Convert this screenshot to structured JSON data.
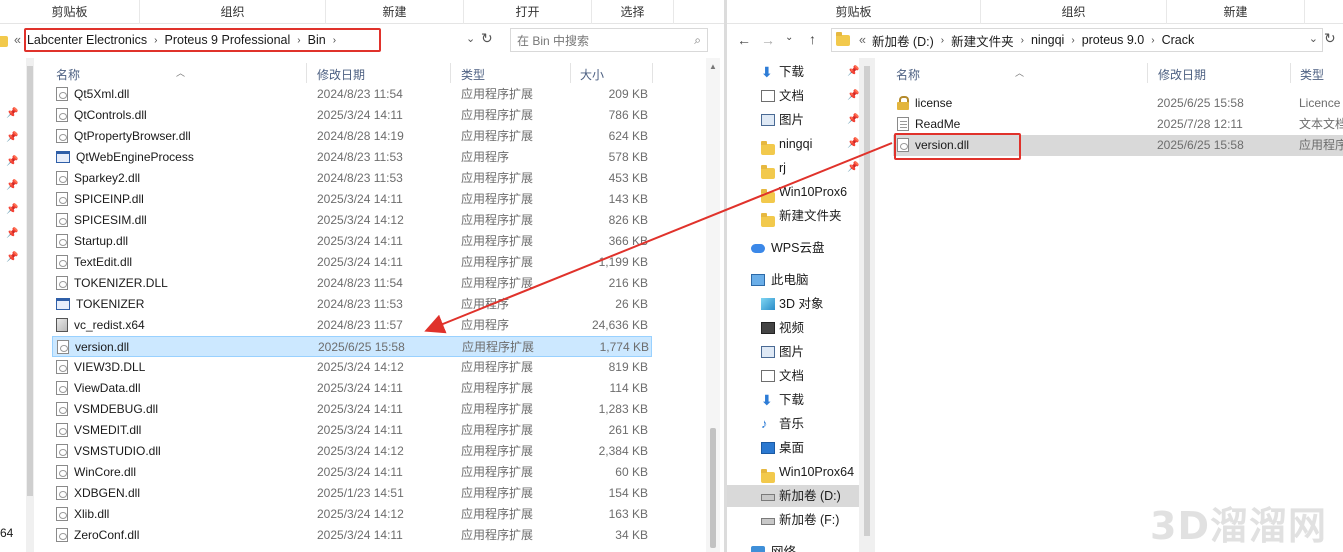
{
  "left": {
    "ribbon": [
      "剪贴板",
      "组织",
      "新建",
      "打开",
      "选择"
    ],
    "address": {
      "prefix": "«",
      "segments": [
        "Labcenter Electronics",
        "Proteus 9 Professional",
        "Bin"
      ]
    },
    "search_placeholder": "在 Bin 中搜索",
    "columns": {
      "name": "名称",
      "date": "修改日期",
      "type": "类型",
      "size": "大小"
    },
    "nav_partial_label": "64",
    "files": [
      {
        "name": "Qt5Xml.dll",
        "date": "2024/8/23 11:54",
        "type": "应用程序扩展",
        "size": "209 KB",
        "icon": "dll"
      },
      {
        "name": "QtControls.dll",
        "date": "2025/3/24 14:11",
        "type": "应用程序扩展",
        "size": "786 KB",
        "icon": "dll"
      },
      {
        "name": "QtPropertyBrowser.dll",
        "date": "2024/8/28 14:19",
        "type": "应用程序扩展",
        "size": "624 KB",
        "icon": "dll"
      },
      {
        "name": "QtWebEngineProcess",
        "date": "2024/8/23 11:53",
        "type": "应用程序",
        "size": "578 KB",
        "icon": "exe"
      },
      {
        "name": "Sparkey2.dll",
        "date": "2024/8/23 11:53",
        "type": "应用程序扩展",
        "size": "453 KB",
        "icon": "dll"
      },
      {
        "name": "SPICEINP.dll",
        "date": "2025/3/24 14:11",
        "type": "应用程序扩展",
        "size": "143 KB",
        "icon": "dll"
      },
      {
        "name": "SPICESIM.dll",
        "date": "2025/3/24 14:12",
        "type": "应用程序扩展",
        "size": "826 KB",
        "icon": "dll"
      },
      {
        "name": "Startup.dll",
        "date": "2025/3/24 14:11",
        "type": "应用程序扩展",
        "size": "366 KB",
        "icon": "dll"
      },
      {
        "name": "TextEdit.dll",
        "date": "2025/3/24 14:11",
        "type": "应用程序扩展",
        "size": "1,199 KB",
        "icon": "dll"
      },
      {
        "name": "TOKENIZER.DLL",
        "date": "2024/8/23 11:54",
        "type": "应用程序扩展",
        "size": "216 KB",
        "icon": "dll"
      },
      {
        "name": "TOKENIZER",
        "date": "2024/8/23 11:53",
        "type": "应用程序",
        "size": "26 KB",
        "icon": "exe"
      },
      {
        "name": "vc_redist.x64",
        "date": "2024/8/23 11:57",
        "type": "应用程序",
        "size": "24,636 KB",
        "icon": "setup"
      },
      {
        "name": "version.dll",
        "date": "2025/6/25 15:58",
        "type": "应用程序扩展",
        "size": "1,774 KB",
        "icon": "dll",
        "selected": true
      },
      {
        "name": "VIEW3D.DLL",
        "date": "2025/3/24 14:12",
        "type": "应用程序扩展",
        "size": "819 KB",
        "icon": "dll"
      },
      {
        "name": "ViewData.dll",
        "date": "2025/3/24 14:11",
        "type": "应用程序扩展",
        "size": "114 KB",
        "icon": "dll"
      },
      {
        "name": "VSMDEBUG.dll",
        "date": "2025/3/24 14:11",
        "type": "应用程序扩展",
        "size": "1,283 KB",
        "icon": "dll"
      },
      {
        "name": "VSMEDIT.dll",
        "date": "2025/3/24 14:11",
        "type": "应用程序扩展",
        "size": "261 KB",
        "icon": "dll"
      },
      {
        "name": "VSMSTUDIO.dll",
        "date": "2025/3/24 14:12",
        "type": "应用程序扩展",
        "size": "2,384 KB",
        "icon": "dll"
      },
      {
        "name": "WinCore.dll",
        "date": "2025/3/24 14:11",
        "type": "应用程序扩展",
        "size": "60 KB",
        "icon": "dll"
      },
      {
        "name": "XDBGEN.dll",
        "date": "2025/1/23 14:51",
        "type": "应用程序扩展",
        "size": "154 KB",
        "icon": "dll"
      },
      {
        "name": "Xlib.dll",
        "date": "2025/3/24 14:12",
        "type": "应用程序扩展",
        "size": "163 KB",
        "icon": "dll"
      },
      {
        "name": "ZeroConf.dll",
        "date": "2025/3/24 14:11",
        "type": "应用程序扩展",
        "size": "34 KB",
        "icon": "dll"
      }
    ]
  },
  "right": {
    "ribbon": [
      "剪贴板",
      "组织",
      "新建"
    ],
    "address": {
      "prefix": "«",
      "segments": [
        "新加卷 (D:)",
        "新建文件夹",
        "ningqi",
        "proteus 9.0",
        "Crack"
      ]
    },
    "columns": {
      "name": "名称",
      "date": "修改日期",
      "type": "类型"
    },
    "nav": [
      {
        "label": "下载",
        "icon": "down",
        "pinned": true
      },
      {
        "label": "文档",
        "icon": "doc",
        "pinned": true
      },
      {
        "label": "图片",
        "icon": "pic",
        "pinned": true
      },
      {
        "label": "ningqi",
        "icon": "folder",
        "pinned": true
      },
      {
        "label": "rj",
        "icon": "folder",
        "pinned": true
      },
      {
        "label": "Win10Prox6",
        "icon": "folder",
        "pinned": false
      },
      {
        "label": "新建文件夹",
        "icon": "folder",
        "pinned": false
      },
      {
        "label": "WPS云盘",
        "icon": "cloud",
        "pinned": false,
        "gap": true
      },
      {
        "label": "此电脑",
        "icon": "pc",
        "pinned": false,
        "gap": true
      },
      {
        "label": "3D 对象",
        "icon": "3d",
        "pinned": false,
        "indent": true
      },
      {
        "label": "视频",
        "icon": "video",
        "pinned": false,
        "indent": true
      },
      {
        "label": "图片",
        "icon": "pic",
        "pinned": false,
        "indent": true
      },
      {
        "label": "文档",
        "icon": "doc",
        "pinned": false,
        "indent": true
      },
      {
        "label": "下载",
        "icon": "down",
        "pinned": false,
        "indent": true
      },
      {
        "label": "音乐",
        "icon": "music",
        "pinned": false,
        "indent": true
      },
      {
        "label": "桌面",
        "icon": "desk",
        "pinned": false,
        "indent": true
      },
      {
        "label": "Win10Prox64",
        "icon": "folder",
        "pinned": false,
        "indent": true
      },
      {
        "label": "新加卷 (D:)",
        "icon": "drive",
        "pinned": false,
        "indent": true,
        "active": true
      },
      {
        "label": "新加卷 (F:)",
        "icon": "drive",
        "pinned": false,
        "indent": true
      },
      {
        "label": "网络",
        "icon": "netw",
        "pinned": false,
        "gap": true
      }
    ],
    "files": [
      {
        "name": "license",
        "date": "2025/6/25 15:58",
        "type": "Licence",
        "icon": "lock"
      },
      {
        "name": "ReadMe",
        "date": "2025/7/28 12:11",
        "type": "文本文档",
        "icon": "txt"
      },
      {
        "name": "version.dll",
        "date": "2025/6/25 15:58",
        "type": "应用程序",
        "icon": "dll",
        "selected": true
      }
    ]
  },
  "watermark": "3D溜溜网",
  "colors": {
    "highlight": "#e0322b",
    "selection": "#cce8ff",
    "header_text": "#4d6082"
  }
}
